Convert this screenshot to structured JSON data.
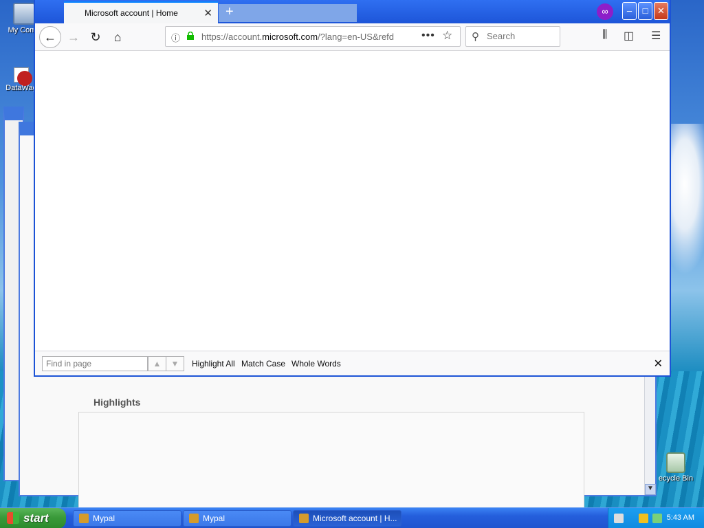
{
  "desktop": {
    "icons": [
      "My Comp",
      "DataWag",
      "ecycle Bin"
    ]
  },
  "background_window": {
    "section_title": "Highlights"
  },
  "browser": {
    "tab_title": "Microsoft account | Home",
    "new_tab_symbol": "+",
    "window_controls": {
      "minimize": "–",
      "maximize": "□",
      "close": "✕"
    },
    "url": {
      "prefix": "https://account.",
      "domain": "microsoft.com",
      "suffix": "/?lang=en-US&refd"
    },
    "search_placeholder": "Search",
    "findbar": {
      "placeholder": "Find in page",
      "highlight_all": "Highlight All",
      "match_case": "Match Case",
      "whole_words": "Whole Words"
    }
  },
  "taskbar": {
    "start_label": "start",
    "items": [
      "Mypal",
      "Mypal",
      "Microsoft account | H..."
    ],
    "clock": "5:43 AM"
  },
  "icons": {
    "back": "back-arrow-icon",
    "forward": "forward-arrow-icon",
    "reload": "reload-icon",
    "home": "home-icon",
    "info": "info-icon",
    "lock": "lock-icon",
    "more": "more-dots-icon",
    "bookmark": "star-icon",
    "search": "search-icon",
    "library": "library-icon",
    "sidebar": "sidebar-icon",
    "menu": "hamburger-menu-icon",
    "private": "private-browsing-mask-icon"
  },
  "colors": {
    "titlebar": "#1d55d8",
    "tab_accent": "#0a84ff",
    "lock": "#12bc00",
    "private": "#8d1ec9"
  }
}
